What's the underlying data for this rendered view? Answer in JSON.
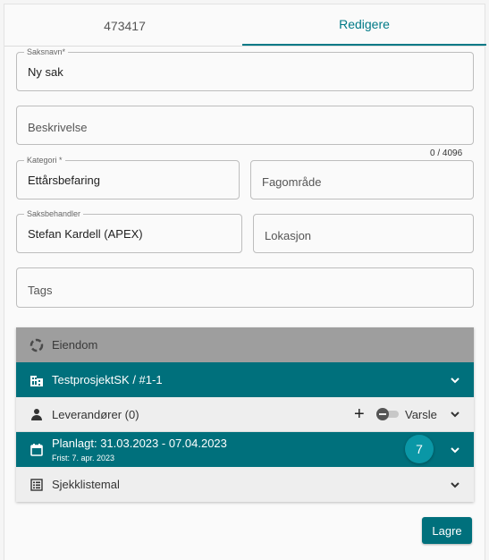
{
  "tabs": [
    {
      "label": "473417"
    },
    {
      "label": "Redigere"
    }
  ],
  "form": {
    "saksnavn": {
      "label": "Saksnavn*",
      "value": "Ny sak"
    },
    "beskrivelse": {
      "placeholder": "Beskrivelse",
      "counter": "0 / 4096"
    },
    "kategori": {
      "label": "Kategori *",
      "value": "Ettårsbefaring"
    },
    "fagomrade": {
      "placeholder": "Fagområde"
    },
    "saksbehandler": {
      "label": "Saksbehandler",
      "value": "Stefan Kardell (APEX)"
    },
    "lokasjon": {
      "placeholder": "Lokasjon"
    },
    "tags": {
      "placeholder": "Tags"
    }
  },
  "sections": {
    "eiendom": {
      "label": "Eiendom"
    },
    "prosjekt": {
      "label": "TestprosjektSK / #1-1"
    },
    "leverandorer": {
      "label": "Leverandører (0)",
      "add": "+",
      "varsle": "Varsle"
    },
    "planlagt": {
      "label": "Planlagt: 31.03.2023 - 07.04.2023",
      "frist": "Frist: 7. apr. 2023",
      "badge": "7"
    },
    "sjekkliste": {
      "label": "Sjekklistemal"
    }
  },
  "actions": {
    "save": "Lagre"
  },
  "colors": {
    "teal": "#00707c",
    "badge": "#0a97a6",
    "gray": "#9e9e9e"
  }
}
